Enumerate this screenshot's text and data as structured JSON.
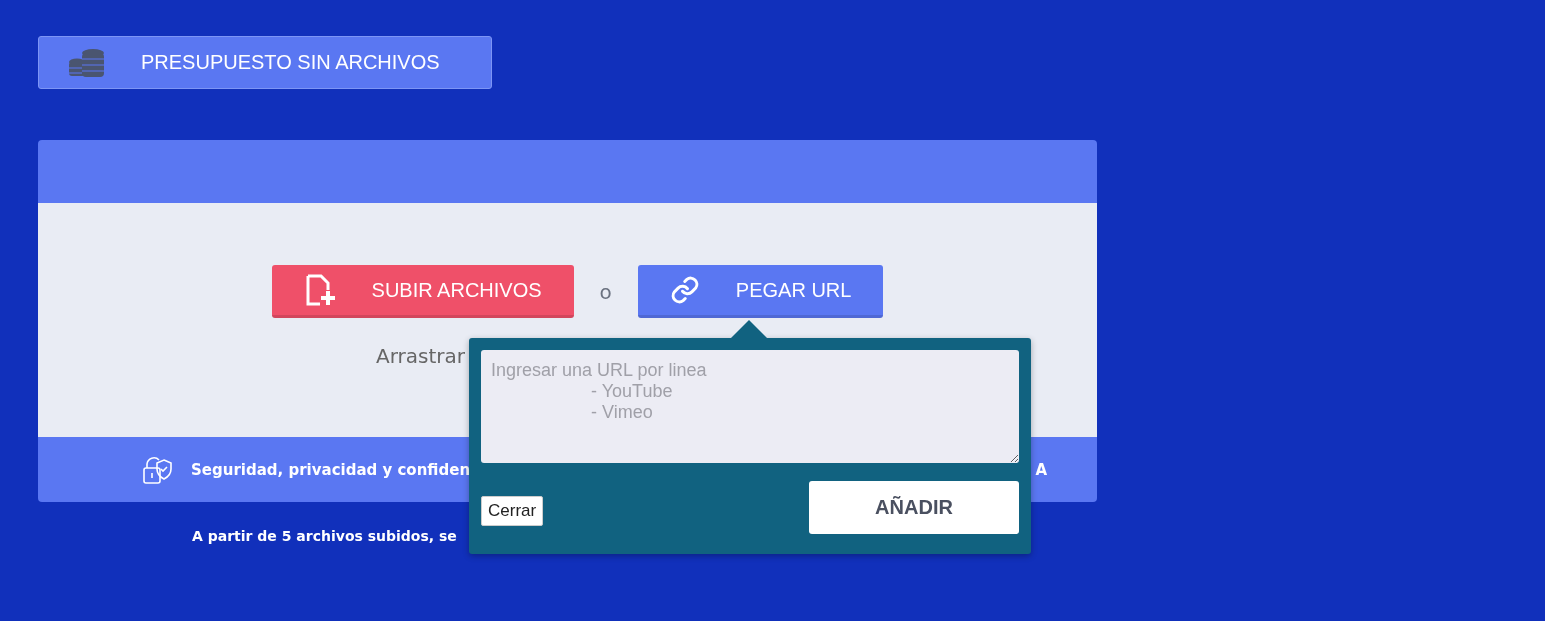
{
  "budget_button": {
    "label": "PRESUPUESTO SIN ARCHIVOS"
  },
  "upload": {
    "upload_button": "SUBIR ARCHIVOS",
    "separator": "o",
    "url_button": "PEGAR URL",
    "drag_hint": "Arrastrar"
  },
  "footer": {
    "security_text": "Seguridad, privacidad y confiden",
    "right_fragment": "A"
  },
  "note": "A partir de 5 archivos subidos, se",
  "url_popover": {
    "placeholder": "Ingresar una URL por linea\n                    - YouTube\n                    - Vimeo",
    "close_button": "Cerrar",
    "add_button": "AÑADIR"
  }
}
